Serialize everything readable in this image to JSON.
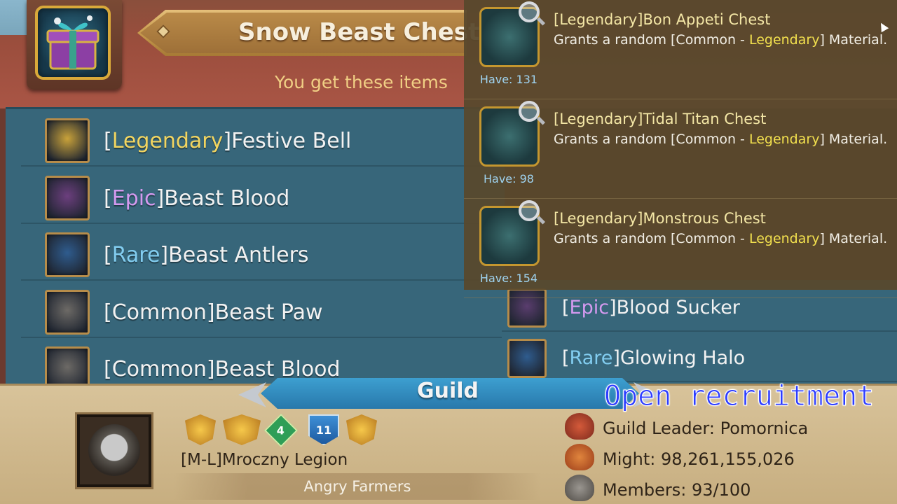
{
  "chest": {
    "title": "Snow Beast Chest",
    "subtitle": "You get these items",
    "icon": "gift-chest-icon"
  },
  "loot": [
    {
      "rarity": "Legendary",
      "rarity_class": "lvl-legendary",
      "name": "Festive Bell",
      "icon": "bell-icon",
      "icon_color": "#c9a23a"
    },
    {
      "rarity": "Epic",
      "rarity_class": "lvl-epic",
      "name": "Beast Blood",
      "icon": "blood-vial-icon",
      "icon_color": "#6c3f7e"
    },
    {
      "rarity": "Rare",
      "rarity_class": "lvl-rare",
      "name": "Beast Antlers",
      "icon": "antlers-icon",
      "icon_color": "#2f5c8e"
    },
    {
      "rarity": "Common",
      "rarity_class": "lvl-common",
      "name": "Beast Paw",
      "icon": "paw-icon",
      "icon_color": "#6d6a66"
    },
    {
      "rarity": "Common",
      "rarity_class": "lvl-common",
      "name": "Beast Blood",
      "icon": "blood-vial-icon",
      "icon_color": "#6d6a66"
    }
  ],
  "right_list": [
    {
      "rarity": "Epic",
      "rarity_class": "lvl-epic",
      "name": "Blood Sucker",
      "icon": "leech-icon",
      "icon_color": "#5a3d6e"
    },
    {
      "rarity": "Rare",
      "rarity_class": "lvl-rare",
      "name": "Glowing Halo",
      "icon": "halo-icon",
      "icon_color": "#2f5c8e"
    }
  ],
  "tooltip": [
    {
      "name": "[Legendary]Bon Appeti Chest",
      "desc_pre": "Grants a random [Common - ",
      "desc_hl": "Legendary",
      "desc_post": "] Material.",
      "have": "Have: 131",
      "icon": "bon-appeti-chest-icon"
    },
    {
      "name": "[Legendary]Tidal Titan Chest",
      "desc_pre": "Grants a random [Common - ",
      "desc_hl": "Legendary",
      "desc_post": "] Material.",
      "have": "Have: 98",
      "icon": "tidal-titan-chest-icon"
    },
    {
      "name": "[Legendary]Monstrous Chest",
      "desc_pre": "Grants a random [Common - ",
      "desc_hl": "Legendary",
      "desc_post": "] Material.",
      "have": "Have: 154",
      "icon": "monstrous-chest-icon"
    }
  ],
  "guild": {
    "tab_label": "Guild",
    "overlay_text": "Open recruitment",
    "name": "[M-L]Mroczny Legion",
    "subtitle": "Angry Farmers",
    "badges": [
      "",
      "",
      "4",
      "11",
      ""
    ],
    "leader": "Guild Leader: Pomornica",
    "might": "Might: 98,261,155,026",
    "members": "Members: 93/100"
  },
  "colors": {
    "legendary": "#f2d560",
    "epic": "#d59af0",
    "rare": "#82cdf0",
    "highlight": "#f2e04e",
    "recruit_text": "#2d3cff"
  }
}
